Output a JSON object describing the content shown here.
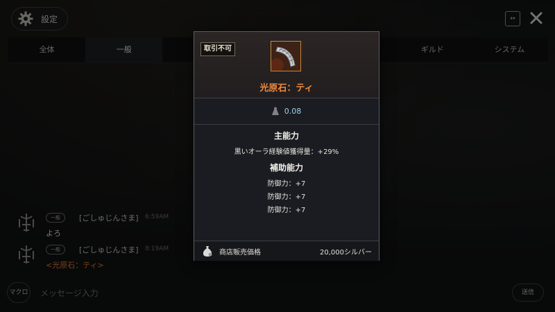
{
  "header": {
    "settings_label": "設定",
    "expand_label": "↔"
  },
  "tabs": [
    {
      "label": "全体",
      "active": false
    },
    {
      "label": "一般",
      "active": true
    },
    {
      "label": "",
      "active": false
    },
    {
      "label": "",
      "active": false
    },
    {
      "label": "",
      "active": false
    },
    {
      "label": "ギルド",
      "active": false
    },
    {
      "label": "システム",
      "active": false
    }
  ],
  "chat": [
    {
      "channel": "一般",
      "sender": "[ごしゅじんさま]",
      "time": "6:59AM",
      "text": "よろ"
    },
    {
      "channel": "一般",
      "sender": "[ごしゅじんさま]",
      "time": "8:19AM",
      "text": "<光原石：ティ>"
    }
  ],
  "input": {
    "macro_label": "マクロ",
    "placeholder": "メッセージ入力",
    "send_label": "送信"
  },
  "tooltip": {
    "untradable": "取引不可",
    "item_name": "光原石：ティ",
    "item_color": "#f08a3a",
    "weight": "0.08",
    "main_title": "主能力",
    "main_stat": "黒いオーラ経験値獲得量：+29%",
    "sub_title": "補助能力",
    "sub_stats": [
      "防御力：+7",
      "防御力：+7",
      "防御力：+7"
    ],
    "shop_label": "商店販売価格",
    "shop_price": "20,000シルバー"
  }
}
